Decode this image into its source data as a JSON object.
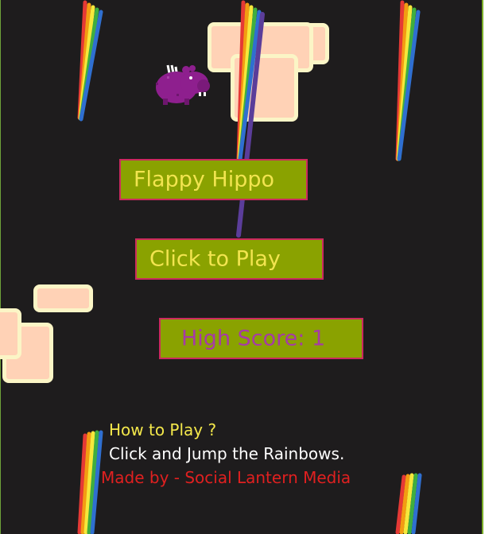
{
  "game": {
    "title": "Flappy Hippo",
    "play_label": "Click to Play",
    "high_score_label": "High Score: 1",
    "high_score": 1
  },
  "instructions": {
    "title": "How to Play ?",
    "text": "Click and Jump the Rainbows."
  },
  "credit": "Made by - Social Lantern Media",
  "colors": {
    "background": "#1e1c1d",
    "button_fill": "#8aa200",
    "button_border": "#cc2a5e",
    "title_text": "#f2e44f",
    "score_text": "#a63aa6",
    "cloud_fill": "#ffd2b6",
    "cloud_border": "#fbf5c6",
    "hippo": "#8e1f8e",
    "rainbow": [
      "#e53935",
      "#f39c12",
      "#f6e83b",
      "#3fae3f",
      "#2f6fd0",
      "#5b3d9a"
    ]
  },
  "sprites": {
    "player": "hippo-icon",
    "obstacle": "rainbow-icon"
  }
}
